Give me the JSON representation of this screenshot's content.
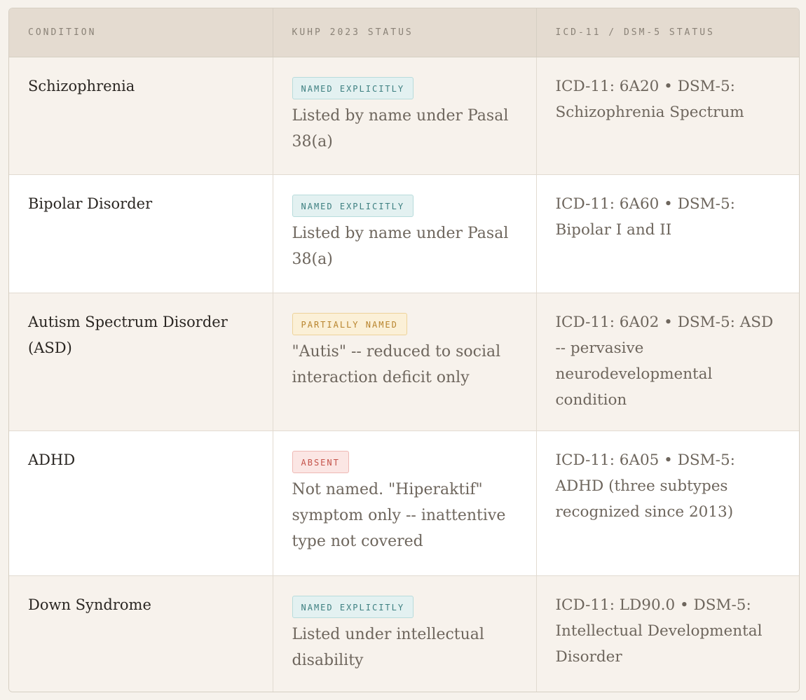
{
  "table": {
    "headers": [
      "CONDITION",
      "KUHP 2023 STATUS",
      "ICD-11 / DSM-5 STATUS"
    ],
    "rows": [
      {
        "condition": "Schizophrenia",
        "badge": "NAMED EXPLICITLY",
        "badge_kind": "named",
        "note": "Listed by name under Pasal 38(a)",
        "reference": "ICD-11: 6A20 • DSM-5: Schizophrenia Spectrum"
      },
      {
        "condition": "Bipolar Disorder",
        "badge": "NAMED EXPLICITLY",
        "badge_kind": "named",
        "note": "Listed by name under Pasal 38(a)",
        "reference": "ICD-11: 6A60 • DSM-5: Bipolar I and II"
      },
      {
        "condition": "Autism Spectrum Disorder (ASD)",
        "badge": "PARTIALLY NAMED",
        "badge_kind": "partial",
        "note": "\"Autis\" -- reduced to social interaction deficit only",
        "reference": "ICD-11: 6A02 • DSM-5: ASD -- pervasive neurodevelopmental condition"
      },
      {
        "condition": "ADHD",
        "badge": "ABSENT",
        "badge_kind": "absent",
        "note": "Not named. \"Hiperaktif\" symptom only -- inattentive type not covered",
        "reference": "ICD-11: 6A05 • DSM-5: ADHD (three subtypes recognized since 2013)"
      },
      {
        "condition": "Down Syndrome",
        "badge": "NAMED EXPLICITLY",
        "badge_kind": "named",
        "note": "Listed under intellectual disability",
        "reference": "ICD-11: LD90.0 • DSM-5: Intellectual Developmental Disorder"
      }
    ]
  },
  "colors": {
    "named_badge": "#3d7f80",
    "partial_badge": "#b8842d",
    "absent_badge": "#c4534a",
    "header_bg": "#e4dbd0"
  }
}
